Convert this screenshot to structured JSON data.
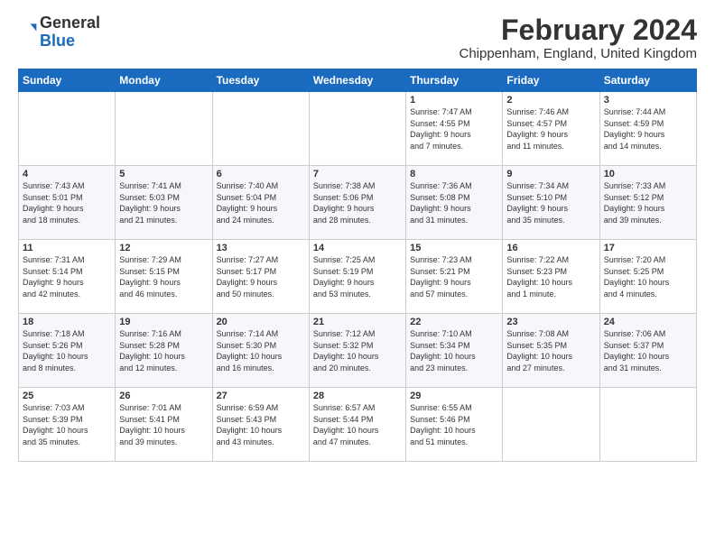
{
  "header": {
    "logo_general": "General",
    "logo_blue": "Blue",
    "month_title": "February 2024",
    "subtitle": "Chippenham, England, United Kingdom"
  },
  "weekdays": [
    "Sunday",
    "Monday",
    "Tuesday",
    "Wednesday",
    "Thursday",
    "Friday",
    "Saturday"
  ],
  "weeks": [
    [
      {
        "day": "",
        "info": ""
      },
      {
        "day": "",
        "info": ""
      },
      {
        "day": "",
        "info": ""
      },
      {
        "day": "",
        "info": ""
      },
      {
        "day": "1",
        "info": "Sunrise: 7:47 AM\nSunset: 4:55 PM\nDaylight: 9 hours\nand 7 minutes."
      },
      {
        "day": "2",
        "info": "Sunrise: 7:46 AM\nSunset: 4:57 PM\nDaylight: 9 hours\nand 11 minutes."
      },
      {
        "day": "3",
        "info": "Sunrise: 7:44 AM\nSunset: 4:59 PM\nDaylight: 9 hours\nand 14 minutes."
      }
    ],
    [
      {
        "day": "4",
        "info": "Sunrise: 7:43 AM\nSunset: 5:01 PM\nDaylight: 9 hours\nand 18 minutes."
      },
      {
        "day": "5",
        "info": "Sunrise: 7:41 AM\nSunset: 5:03 PM\nDaylight: 9 hours\nand 21 minutes."
      },
      {
        "day": "6",
        "info": "Sunrise: 7:40 AM\nSunset: 5:04 PM\nDaylight: 9 hours\nand 24 minutes."
      },
      {
        "day": "7",
        "info": "Sunrise: 7:38 AM\nSunset: 5:06 PM\nDaylight: 9 hours\nand 28 minutes."
      },
      {
        "day": "8",
        "info": "Sunrise: 7:36 AM\nSunset: 5:08 PM\nDaylight: 9 hours\nand 31 minutes."
      },
      {
        "day": "9",
        "info": "Sunrise: 7:34 AM\nSunset: 5:10 PM\nDaylight: 9 hours\nand 35 minutes."
      },
      {
        "day": "10",
        "info": "Sunrise: 7:33 AM\nSunset: 5:12 PM\nDaylight: 9 hours\nand 39 minutes."
      }
    ],
    [
      {
        "day": "11",
        "info": "Sunrise: 7:31 AM\nSunset: 5:14 PM\nDaylight: 9 hours\nand 42 minutes."
      },
      {
        "day": "12",
        "info": "Sunrise: 7:29 AM\nSunset: 5:15 PM\nDaylight: 9 hours\nand 46 minutes."
      },
      {
        "day": "13",
        "info": "Sunrise: 7:27 AM\nSunset: 5:17 PM\nDaylight: 9 hours\nand 50 minutes."
      },
      {
        "day": "14",
        "info": "Sunrise: 7:25 AM\nSunset: 5:19 PM\nDaylight: 9 hours\nand 53 minutes."
      },
      {
        "day": "15",
        "info": "Sunrise: 7:23 AM\nSunset: 5:21 PM\nDaylight: 9 hours\nand 57 minutes."
      },
      {
        "day": "16",
        "info": "Sunrise: 7:22 AM\nSunset: 5:23 PM\nDaylight: 10 hours\nand 1 minute."
      },
      {
        "day": "17",
        "info": "Sunrise: 7:20 AM\nSunset: 5:25 PM\nDaylight: 10 hours\nand 4 minutes."
      }
    ],
    [
      {
        "day": "18",
        "info": "Sunrise: 7:18 AM\nSunset: 5:26 PM\nDaylight: 10 hours\nand 8 minutes."
      },
      {
        "day": "19",
        "info": "Sunrise: 7:16 AM\nSunset: 5:28 PM\nDaylight: 10 hours\nand 12 minutes."
      },
      {
        "day": "20",
        "info": "Sunrise: 7:14 AM\nSunset: 5:30 PM\nDaylight: 10 hours\nand 16 minutes."
      },
      {
        "day": "21",
        "info": "Sunrise: 7:12 AM\nSunset: 5:32 PM\nDaylight: 10 hours\nand 20 minutes."
      },
      {
        "day": "22",
        "info": "Sunrise: 7:10 AM\nSunset: 5:34 PM\nDaylight: 10 hours\nand 23 minutes."
      },
      {
        "day": "23",
        "info": "Sunrise: 7:08 AM\nSunset: 5:35 PM\nDaylight: 10 hours\nand 27 minutes."
      },
      {
        "day": "24",
        "info": "Sunrise: 7:06 AM\nSunset: 5:37 PM\nDaylight: 10 hours\nand 31 minutes."
      }
    ],
    [
      {
        "day": "25",
        "info": "Sunrise: 7:03 AM\nSunset: 5:39 PM\nDaylight: 10 hours\nand 35 minutes."
      },
      {
        "day": "26",
        "info": "Sunrise: 7:01 AM\nSunset: 5:41 PM\nDaylight: 10 hours\nand 39 minutes."
      },
      {
        "day": "27",
        "info": "Sunrise: 6:59 AM\nSunset: 5:43 PM\nDaylight: 10 hours\nand 43 minutes."
      },
      {
        "day": "28",
        "info": "Sunrise: 6:57 AM\nSunset: 5:44 PM\nDaylight: 10 hours\nand 47 minutes."
      },
      {
        "day": "29",
        "info": "Sunrise: 6:55 AM\nSunset: 5:46 PM\nDaylight: 10 hours\nand 51 minutes."
      },
      {
        "day": "",
        "info": ""
      },
      {
        "day": "",
        "info": ""
      }
    ]
  ]
}
